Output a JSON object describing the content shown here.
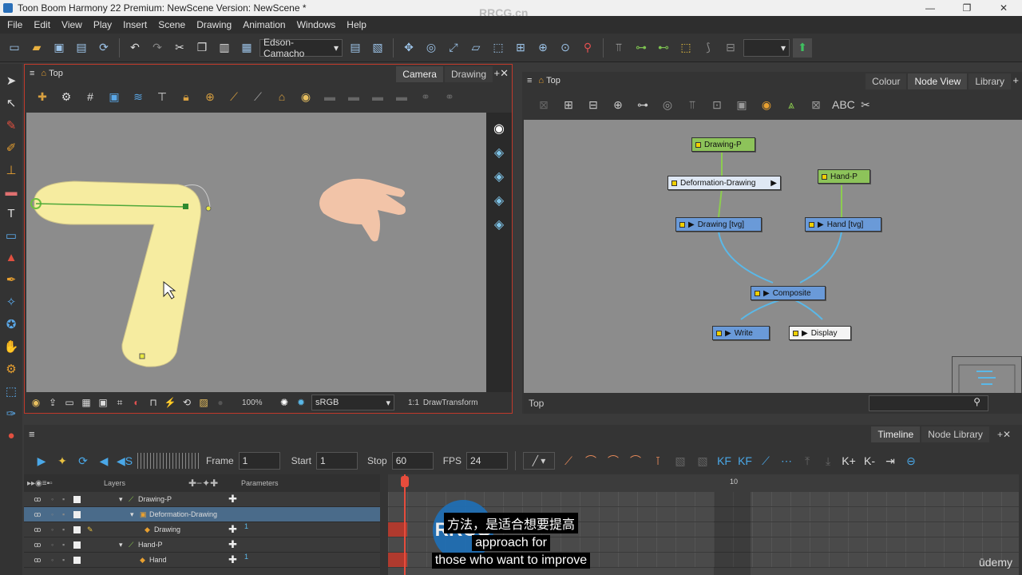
{
  "window": {
    "title": "Toon Boom Harmony 22 Premium: NewScene Version: NewScene *",
    "controls": [
      "—",
      "❐",
      "✕"
    ]
  },
  "watermark": "RRCG.cn",
  "menu": [
    "File",
    "Edit",
    "View",
    "Play",
    "Insert",
    "Scene",
    "Drawing",
    "Animation",
    "Windows",
    "Help"
  ],
  "toolbar": {
    "user_dropdown": "Edson-Camacho"
  },
  "camera_panel": {
    "breadcrumb": "Top",
    "tabs": [
      "Camera",
      "Drawing"
    ],
    "active_tab": "Camera",
    "status": {
      "zoom": "100%",
      "color_space": "sRGB",
      "ratio": "1:1",
      "tool": "DrawTransform"
    }
  },
  "node_panel": {
    "breadcrumb": "Top",
    "tabs": [
      "Colour",
      "Node View",
      "Library"
    ],
    "active_tab": "Node View",
    "status_path": "Top",
    "nodes": {
      "drawing_p": "Drawing-P",
      "deformation": "Deformation-Drawing",
      "hand_p": "Hand-P",
      "drawing": "Drawing [tvg]",
      "hand": "Hand [tvg]",
      "composite": "Composite",
      "write": "Write",
      "display": "Display"
    }
  },
  "timeline": {
    "tabs": [
      "Timeline",
      "Node Library"
    ],
    "active_tab": "Timeline",
    "frame_label": "Frame",
    "frame_value": "1",
    "start_label": "Start",
    "start_value": "1",
    "stop_label": "Stop",
    "stop_value": "60",
    "fps_label": "FPS",
    "fps_value": "24",
    "layers_header": "Layers",
    "parameters_header": "Parameters",
    "ruler_mark": "10",
    "layers": [
      {
        "name": "Drawing-P",
        "selected": false
      },
      {
        "name": "Deformation-Drawing",
        "selected": true
      },
      {
        "name": "Drawing",
        "selected": false,
        "value": "1"
      },
      {
        "name": "Hand-P",
        "selected": false
      },
      {
        "name": "Hand",
        "selected": false,
        "value": "1"
      }
    ]
  },
  "subtitles": {
    "line1": "方法，是适合想要提高",
    "line2": "approach for",
    "line3": "those who want to improve"
  },
  "branding": {
    "logo": "RRCG",
    "udemy": "ūdemy"
  }
}
